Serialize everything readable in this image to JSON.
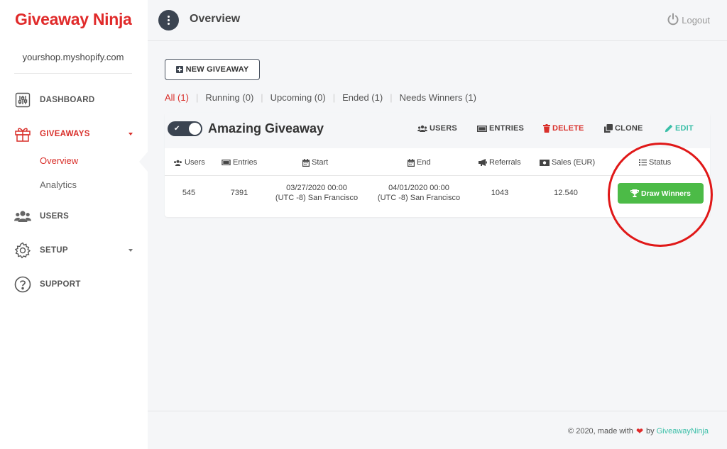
{
  "app": {
    "brand": "Giveaway Ninja",
    "shop": "yourshop.myshopify.com"
  },
  "sidebar": {
    "items": [
      {
        "label": "DASHBOARD",
        "icon": "sliders-icon"
      },
      {
        "label": "GIVEAWAYS",
        "icon": "gift-icon",
        "active": true
      },
      {
        "label": "USERS",
        "icon": "users-icon"
      },
      {
        "label": "SETUP",
        "icon": "gear-icon"
      },
      {
        "label": "SUPPORT",
        "icon": "help-circle-icon"
      }
    ],
    "subitems": [
      {
        "label": "Overview",
        "active": true
      },
      {
        "label": "Analytics"
      }
    ]
  },
  "header": {
    "title": "Overview",
    "logout": "Logout"
  },
  "toolbar": {
    "new_giveaway": "NEW GIVEAWAY"
  },
  "filters": [
    "All (1)",
    "Running (0)",
    "Upcoming (0)",
    "Ended (1)",
    "Needs Winners (1)"
  ],
  "giveaway": {
    "name": "Amazing Giveaway",
    "enabled": true,
    "actions": {
      "users": "USERS",
      "entries": "ENTRIES",
      "delete": "DELETE",
      "clone": "CLONE",
      "edit": "EDIT"
    },
    "columns": [
      "Users",
      "Entries",
      "Start",
      "End",
      "Referrals",
      "Sales (EUR)",
      "Status"
    ],
    "row": {
      "users": "545",
      "entries": "7391",
      "start_date": "03/27/2020 00:00",
      "start_tz": "(UTC -8) San Francisco",
      "end_date": "04/01/2020 00:00",
      "end_tz": "(UTC -8) San Francisco",
      "referrals": "1043",
      "sales": "12.540",
      "status_button": "Draw Winners"
    }
  },
  "footer": {
    "text": "© 2020, made with",
    "by": "by",
    "brand": "GiveawayNinja"
  },
  "colors": {
    "brand": "#e02a2a",
    "accent": "#3bbfa8",
    "success": "#4cbb47",
    "dark": "#3b4451",
    "annotation": "#e01818"
  }
}
